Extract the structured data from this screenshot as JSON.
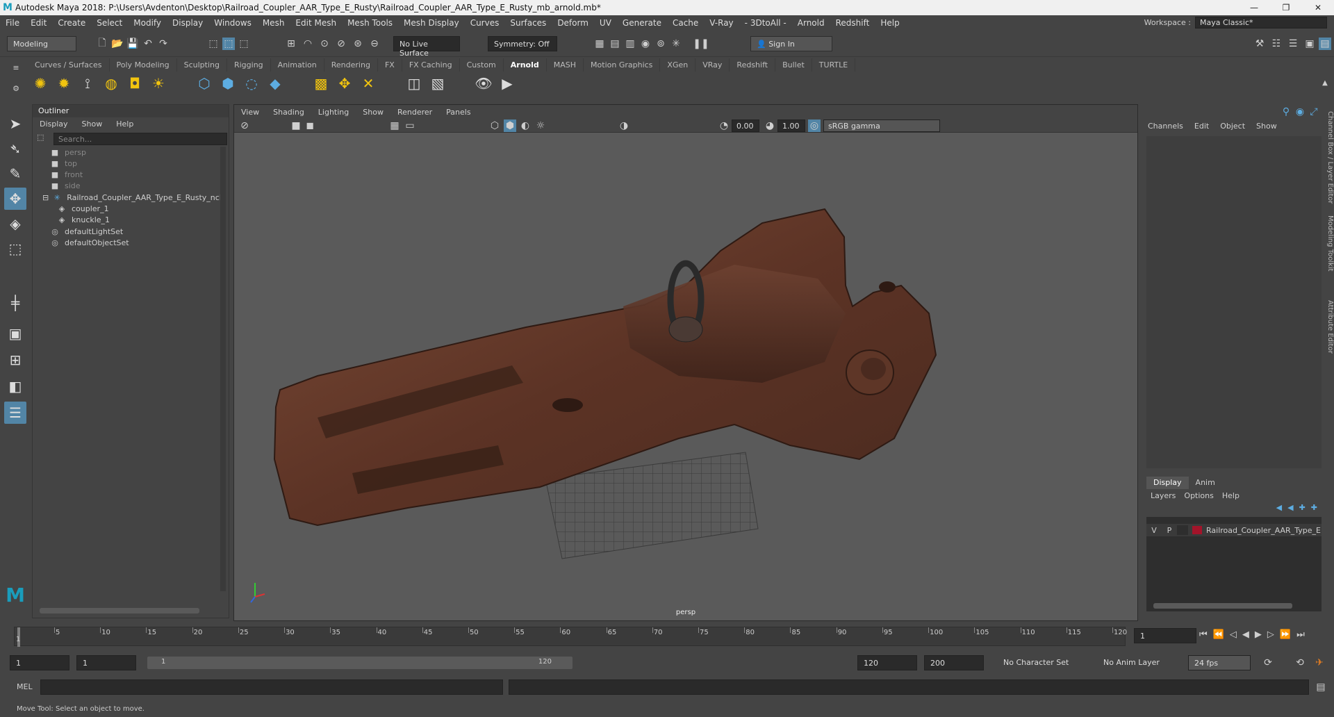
{
  "titlebar": {
    "title": "Autodesk Maya 2018: P:\\Users\\Avdenton\\Desktop\\Railroad_Coupler_AAR_Type_E_Rusty\\Railroad_Coupler_AAR_Type_E_Rusty_mb_arnold.mb*",
    "minimize": "—",
    "maximize": "❐",
    "close": "✕"
  },
  "menubar": {
    "items": [
      "File",
      "Edit",
      "Create",
      "Select",
      "Modify",
      "Display",
      "Windows",
      "Mesh",
      "Edit Mesh",
      "Mesh Tools",
      "Mesh Display",
      "Curves",
      "Surfaces",
      "Deform",
      "UV",
      "Generate",
      "Cache",
      "V-Ray",
      "- 3DtoAll -",
      "Arnold",
      "Redshift",
      "Help"
    ],
    "workspace_label": "Workspace :",
    "workspace_value": "Maya Classic*"
  },
  "statusline": {
    "mode": "Modeling",
    "live_surface": "No Live Surface",
    "symmetry": "Symmetry: Off",
    "sign_in": "Sign In"
  },
  "shelf": {
    "tabs": [
      "Curves / Surfaces",
      "Poly Modeling",
      "Sculpting",
      "Rigging",
      "Animation",
      "Rendering",
      "FX",
      "FX Caching",
      "Custom",
      "Arnold",
      "MASH",
      "Motion Graphics",
      "XGen",
      "VRay",
      "Redshift",
      "Bullet",
      "TURTLE"
    ],
    "active_tab": "Arnold"
  },
  "outliner": {
    "title": "Outliner",
    "menu": [
      "Display",
      "Show",
      "Help"
    ],
    "search_placeholder": "Search...",
    "items": [
      {
        "label": "persp",
        "icon": "camera-icon",
        "dim": true
      },
      {
        "label": "top",
        "icon": "camera-icon",
        "dim": true
      },
      {
        "label": "front",
        "icon": "camera-icon",
        "dim": true
      },
      {
        "label": "side",
        "icon": "camera-icon",
        "dim": true
      },
      {
        "label": "Railroad_Coupler_AAR_Type_E_Rusty_ncl",
        "icon": "group-icon",
        "dim": false
      },
      {
        "label": "coupler_1",
        "icon": "mesh-icon",
        "dim": false
      },
      {
        "label": "knuckle_1",
        "icon": "mesh-icon",
        "dim": false
      },
      {
        "label": "defaultLightSet",
        "icon": "set-icon",
        "dim": false
      },
      {
        "label": "defaultObjectSet",
        "icon": "set-icon",
        "dim": false
      }
    ]
  },
  "viewport": {
    "menu": [
      "View",
      "Shading",
      "Lighting",
      "Show",
      "Renderer",
      "Panels"
    ],
    "exposure": "0.00",
    "gamma": "1.00",
    "color_space": "sRGB gamma",
    "camera_label": "persp"
  },
  "channelbox": {
    "menu": [
      "Channels",
      "Edit",
      "Object",
      "Show"
    ]
  },
  "layereditor": {
    "tabs": [
      "Display",
      "Anim"
    ],
    "menu": [
      "Layers",
      "Options",
      "Help"
    ],
    "layer": {
      "v": "V",
      "p": "P",
      "name": "Railroad_Coupler_AAR_Type_E"
    }
  },
  "sidetabs": [
    "Channel Box / Layer Editor",
    "Modeling Toolkit",
    "Attribute Editor"
  ],
  "timeline": {
    "ticks": [
      "5",
      "10",
      "15",
      "20",
      "25",
      "30",
      "35",
      "40",
      "45",
      "50",
      "55",
      "60",
      "65",
      "70",
      "75",
      "80",
      "85",
      "90",
      "95",
      "100",
      "105",
      "110",
      "115",
      "120"
    ],
    "current_frame_left": "1",
    "current_frame_field": "1"
  },
  "range": {
    "start": "1",
    "start2": "1",
    "slider_start": "1",
    "slider_end": "120",
    "end": "120",
    "end2": "200",
    "character_set": "No Character Set",
    "anim_layer": "No Anim Layer",
    "fps": "24 fps"
  },
  "cmdline": {
    "label": "MEL"
  },
  "helpline": {
    "text": "Move Tool: Select an object to move."
  },
  "colors": {
    "accent": "#5285a6",
    "layer_color": "#a3142a",
    "rust": "#6a3b2a"
  }
}
